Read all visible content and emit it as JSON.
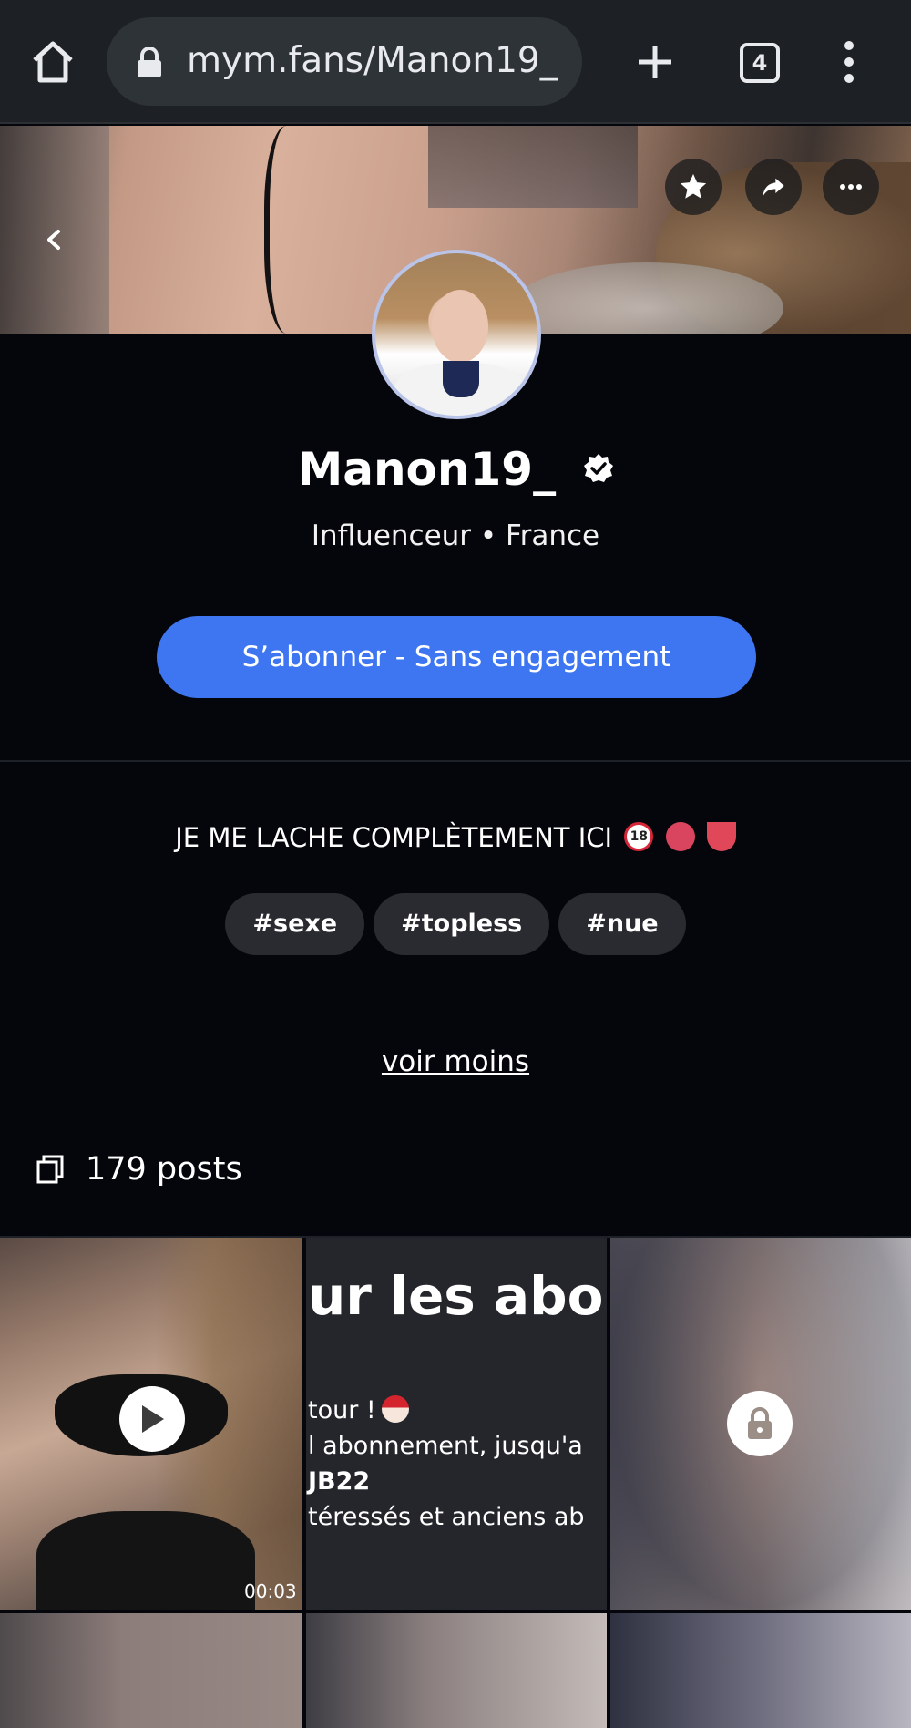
{
  "browser": {
    "url": "mym.fans/Manon19_",
    "tab_count": "4"
  },
  "profile": {
    "name": "Manon19_",
    "subtitle": "Influenceur • France",
    "subscribe_label": "S’abonner - Sans engagement",
    "bio": "JE ME LACHE COMPLÈTEMENT ICI",
    "bio_emoji_18": "18",
    "tags": [
      "#sexe",
      "#topless",
      "#nue"
    ],
    "toggle_label": "voir moins",
    "posts_count": "179 posts"
  },
  "posts": {
    "video_duration": "00:03",
    "promo_lines": {
      "headline": "ur les abo",
      "line1": "tour !",
      "line2": "l abonnement, jusqu'a",
      "line3": "JB22",
      "line4": "téressés et anciens ab"
    }
  },
  "colors": {
    "accent": "#3e76f2",
    "background": "#05060b",
    "chrome": "#1d2024",
    "tag_bg": "#2a2b30"
  },
  "icons": [
    "home-icon",
    "lock-icon",
    "plus-icon",
    "tabs-icon",
    "kebab-menu-icon",
    "back-chevron-icon",
    "star-icon",
    "share-icon",
    "more-icon",
    "verified-icon",
    "posts-icon",
    "play-icon",
    "padlock-icon"
  ]
}
